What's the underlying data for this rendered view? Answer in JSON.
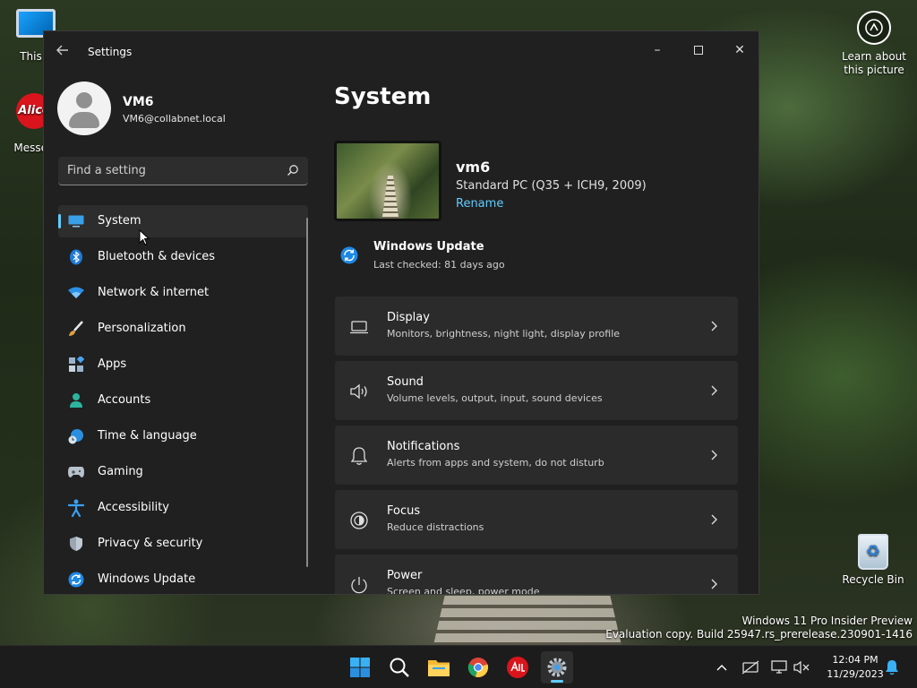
{
  "desktop": {
    "this_pc_label": "This P",
    "messenger_label": "Messen",
    "messenger_logo_text": "Alice",
    "learn_label": "Learn about this picture",
    "recycle_label": "Recycle Bin",
    "watermark_line1": "Windows 11 Pro Insider Preview",
    "watermark_line2": "Evaluation copy. Build 25947.rs_prerelease.230901-1416"
  },
  "window": {
    "title": "Settings",
    "controls": {
      "minimize": "–",
      "close": "✕"
    }
  },
  "profile": {
    "name": "VM6",
    "email": "VM6@collabnet.local"
  },
  "search": {
    "placeholder": "Find a setting"
  },
  "nav": {
    "items": [
      {
        "label": "System",
        "icon": "system-icon",
        "selected": true
      },
      {
        "label": "Bluetooth & devices",
        "icon": "bluetooth-icon"
      },
      {
        "label": "Network & internet",
        "icon": "wifi-icon"
      },
      {
        "label": "Personalization",
        "icon": "brush-icon"
      },
      {
        "label": "Apps",
        "icon": "apps-icon"
      },
      {
        "label": "Accounts",
        "icon": "accounts-icon"
      },
      {
        "label": "Time & language",
        "icon": "globe-clock-icon"
      },
      {
        "label": "Gaming",
        "icon": "gamepad-icon"
      },
      {
        "label": "Accessibility",
        "icon": "accessibility-icon"
      },
      {
        "label": "Privacy & security",
        "icon": "shield-icon"
      },
      {
        "label": "Windows Update",
        "icon": "update-icon"
      }
    ]
  },
  "main": {
    "page_title": "System",
    "device": {
      "name": "vm6",
      "model": "Standard PC (Q35 + ICH9, 2009)",
      "rename": "Rename"
    },
    "windows_update": {
      "title": "Windows Update",
      "subtitle": "Last checked: 81 days ago"
    },
    "cards": [
      {
        "title": "Display",
        "subtitle": "Monitors, brightness, night light, display profile",
        "icon": "laptop-icon"
      },
      {
        "title": "Sound",
        "subtitle": "Volume levels, output, input, sound devices",
        "icon": "speaker-icon"
      },
      {
        "title": "Notifications",
        "subtitle": "Alerts from apps and system, do not disturb",
        "icon": "bell-icon"
      },
      {
        "title": "Focus",
        "subtitle": "Reduce distractions",
        "icon": "focus-icon"
      },
      {
        "title": "Power",
        "subtitle": "Screen and sleep, power mode",
        "icon": "power-icon"
      }
    ]
  },
  "taskbar": {
    "time": "12:04 PM",
    "date": "11/29/2023"
  },
  "colors": {
    "accent": "#60cdff",
    "window_bg": "#202020",
    "card_bg": "#2b2b2b"
  }
}
